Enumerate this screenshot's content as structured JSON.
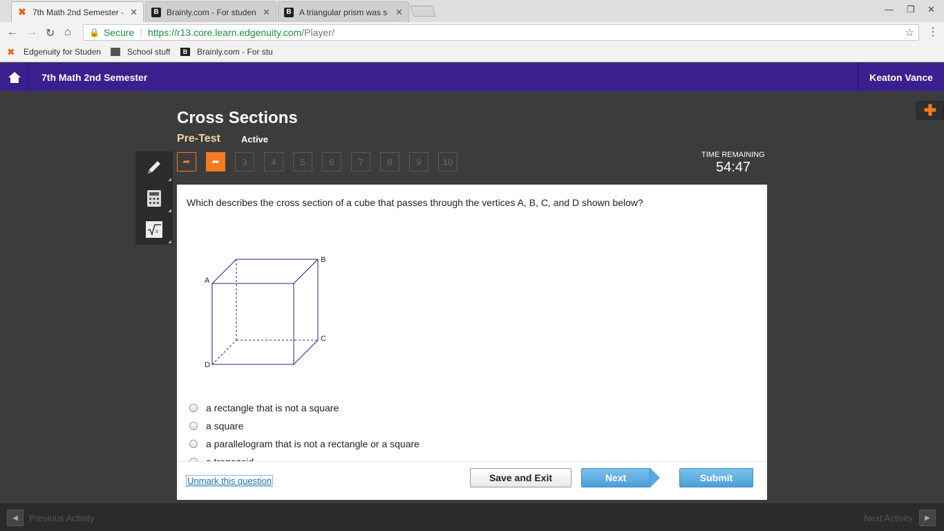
{
  "browser": {
    "tabs": [
      {
        "title": "7th Math 2nd Semester -",
        "favicon": "edgenuity-icon",
        "active": true
      },
      {
        "title": "Brainly.com - For studen",
        "favicon": "brainly-icon",
        "active": false
      },
      {
        "title": "A triangular prism was s",
        "favicon": "brainly-icon",
        "active": false
      }
    ],
    "security_label": "Secure",
    "url_host": "https://r13.core.learn.edgenuity.com",
    "url_path": "/Player/",
    "bookmarks": [
      {
        "label": "Edgenuity for Studen",
        "icon": "edgenuity-icon"
      },
      {
        "label": "School stuff",
        "icon": "folder-icon"
      },
      {
        "label": "Brainly.com - For stu",
        "icon": "brainly-icon"
      }
    ]
  },
  "header": {
    "course_title": "7th Math 2nd Semester",
    "user_name": "Keaton Vance"
  },
  "lesson": {
    "title": "Cross Sections",
    "activity_type": "Pre-Test",
    "status": "Active"
  },
  "question_nav": {
    "numbers": [
      "3",
      "4",
      "5",
      "6",
      "7",
      "8",
      "9",
      "10"
    ]
  },
  "timer": {
    "label": "TIME REMAINING",
    "value": "54:47"
  },
  "question": {
    "text": "Which describes the cross section of a cube that passes through the vertices A, B, C, and D shown below?",
    "figure_labels": {
      "a": "A",
      "b": "B",
      "c": "C",
      "d": "D"
    },
    "choices": [
      "a rectangle that is not a square",
      "a square",
      "a parallelogram that is not a rectangle or a square",
      "a trapezoid"
    ]
  },
  "footer": {
    "unmark_label": "Unmark this question",
    "save_label": "Save and Exit",
    "next_label": "Next",
    "submit_label": "Submit"
  },
  "bottom": {
    "previous_label": "Previous Activity",
    "next_label": "Next Activity"
  },
  "colors": {
    "header_purple": "#3b1f8e",
    "accent_orange": "#f47b20",
    "button_blue": "#4a9fd8",
    "cube_blue": "#1a237e"
  }
}
